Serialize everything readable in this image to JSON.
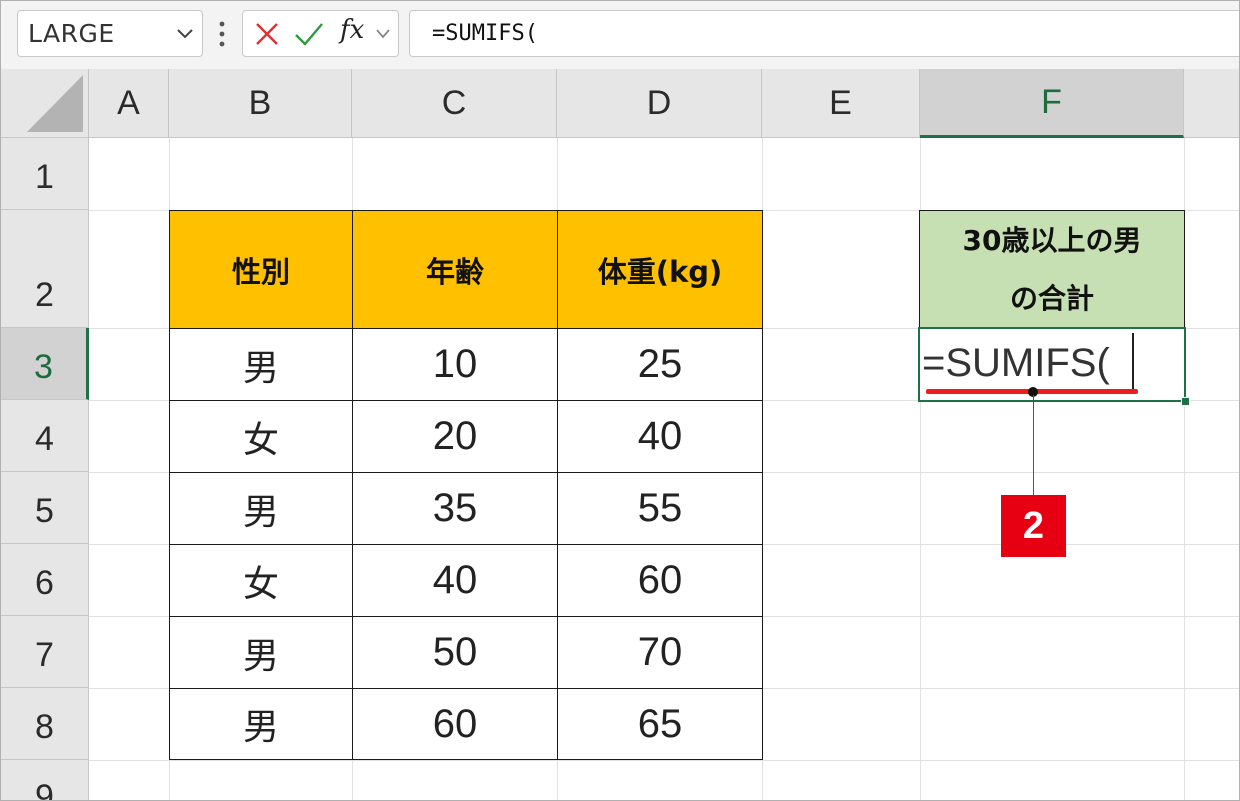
{
  "formula_bar": {
    "name_box": "LARGE",
    "fx_label": "fx",
    "formula": "=SUMIFS("
  },
  "columns": [
    "A",
    "B",
    "C",
    "D",
    "E",
    "F"
  ],
  "rows": [
    "1",
    "2",
    "3",
    "4",
    "5",
    "6",
    "7",
    "8",
    "9"
  ],
  "selected_column": "F",
  "selected_row": "3",
  "table": {
    "headers": [
      "性別",
      "年齢",
      "体重(kg)"
    ],
    "rows": [
      [
        "男",
        "10",
        "25"
      ],
      [
        "女",
        "20",
        "40"
      ],
      [
        "男",
        "35",
        "55"
      ],
      [
        "女",
        "40",
        "60"
      ],
      [
        "男",
        "50",
        "70"
      ],
      [
        "男",
        "60",
        "65"
      ]
    ]
  },
  "result_header": {
    "line1": "30歳以上の男",
    "line2": "の合計"
  },
  "active_cell_text": "=SUMIFS(",
  "callout": {
    "label": "2"
  },
  "colors": {
    "header_fill": "#ffc000",
    "result_fill": "#c6e0b4",
    "selection": "#1e7145",
    "underline": "#ee1c1c",
    "badge": "#e60012"
  },
  "icons": [
    "chevron-down-icon",
    "more-vertical-icon",
    "cancel-x-icon",
    "check-icon",
    "fx-function-icon"
  ]
}
